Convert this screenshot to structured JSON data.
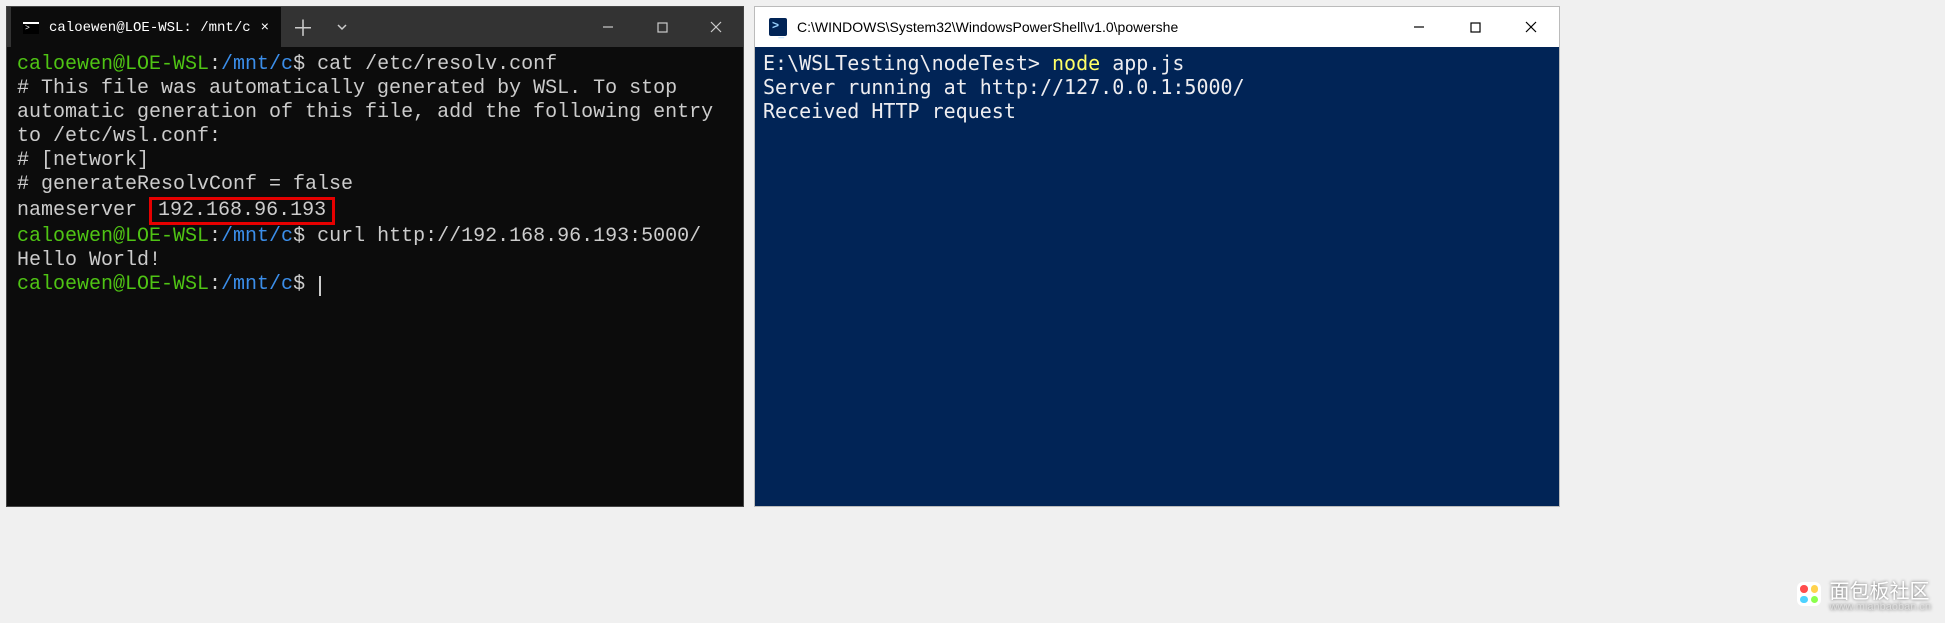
{
  "left": {
    "tab_title": "caloewen@LOE-WSL: /mnt/c",
    "prompt": {
      "userhost": "caloewen@LOE-WSL",
      "path": "/mnt/c",
      "dollar": "$"
    },
    "cmd1": "cat /etc/resolv.conf",
    "out1_l1": "# This file was automatically generated by WSL. To stop automatic generation of this file, add the following entry to /etc/wsl.conf:",
    "out1_l2": "# [network]",
    "out1_l3": "# generateResolvConf = false",
    "out1_ns_label": "nameserver",
    "out1_ns_ip": "192.168.96.193",
    "cmd2": "curl http://192.168.96.193:5000/",
    "out2": "Hello World!"
  },
  "right": {
    "title": "C:\\WINDOWS\\System32\\WindowsPowerShell\\v1.0\\powershe",
    "prompt": "E:\\WSLTesting\\nodeTest>",
    "cmd_verb": "node",
    "cmd_arg": "app.js",
    "out_l1": "Server running at http://127.0.0.1:5000/",
    "out_l2": "Received HTTP request"
  },
  "watermark": {
    "text": "面包板社区",
    "sub": "www.mianbaoban.cn"
  }
}
